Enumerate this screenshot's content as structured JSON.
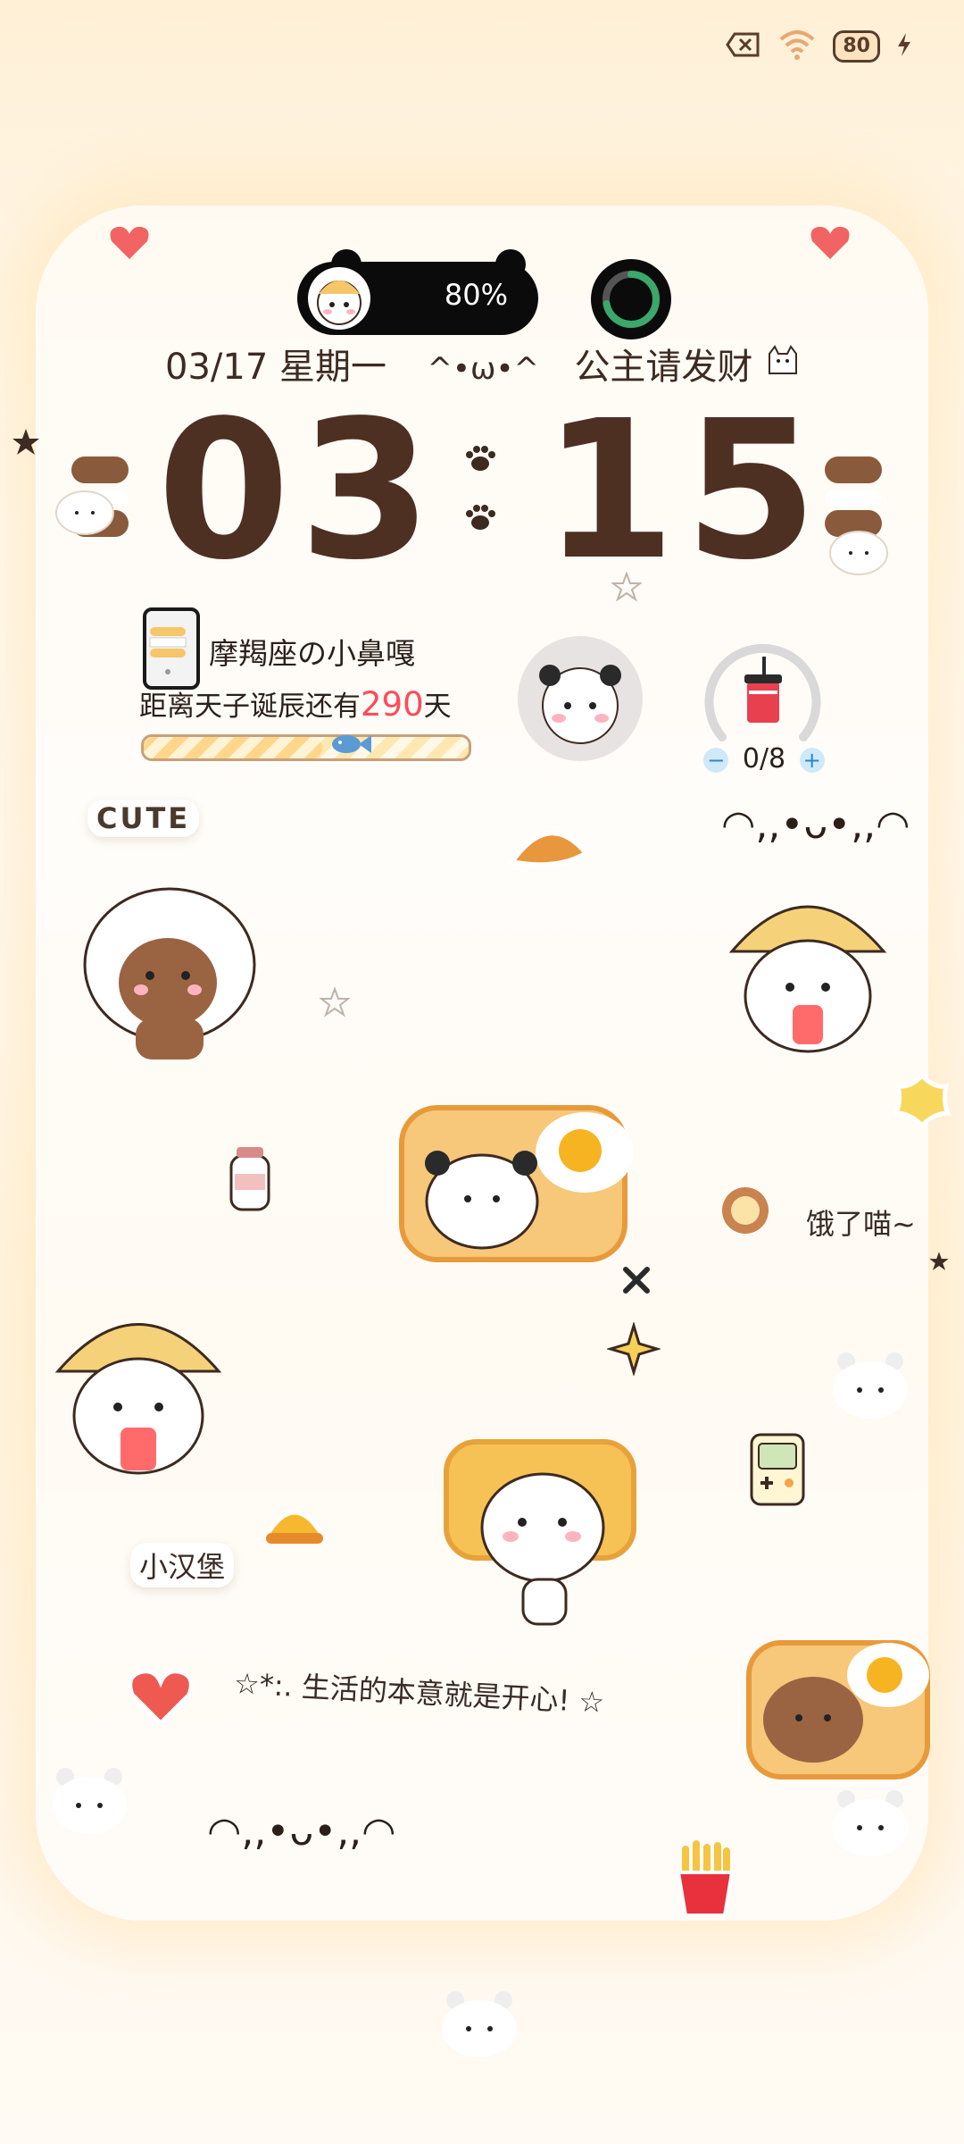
{
  "status_bar": {
    "battery": "80"
  },
  "capsule": {
    "battery_percent": "80%",
    "ring_progress": 0.72
  },
  "lock": {
    "date": "03/17 星期一",
    "face": "^•ω•^",
    "motto": "公主请发财",
    "hour": "03",
    "minute": "15"
  },
  "countdown": {
    "name": "摩羯座の小鼻嘎",
    "prefix": "距离天子诞辰还有",
    "days": "290",
    "suffix": "天",
    "progress": 0.55
  },
  "water": {
    "count": "0/8",
    "minus": "−",
    "plus": "+"
  },
  "stickers": {
    "cute": "CUTE",
    "kaomoji_top": "◠,,•ᴗ•,,◠",
    "hungry": "饿了喵~",
    "burger": "小汉堡",
    "life": "☆*:. 生活的本意就是开心! ☆",
    "kaomoji_bottom": "◠,,•ᴗ•,,◠"
  },
  "colors": {
    "accent": "#ff4a58",
    "brown": "#4e3023",
    "capsule": "#0b0b0b",
    "ring": "#3aa86a"
  }
}
